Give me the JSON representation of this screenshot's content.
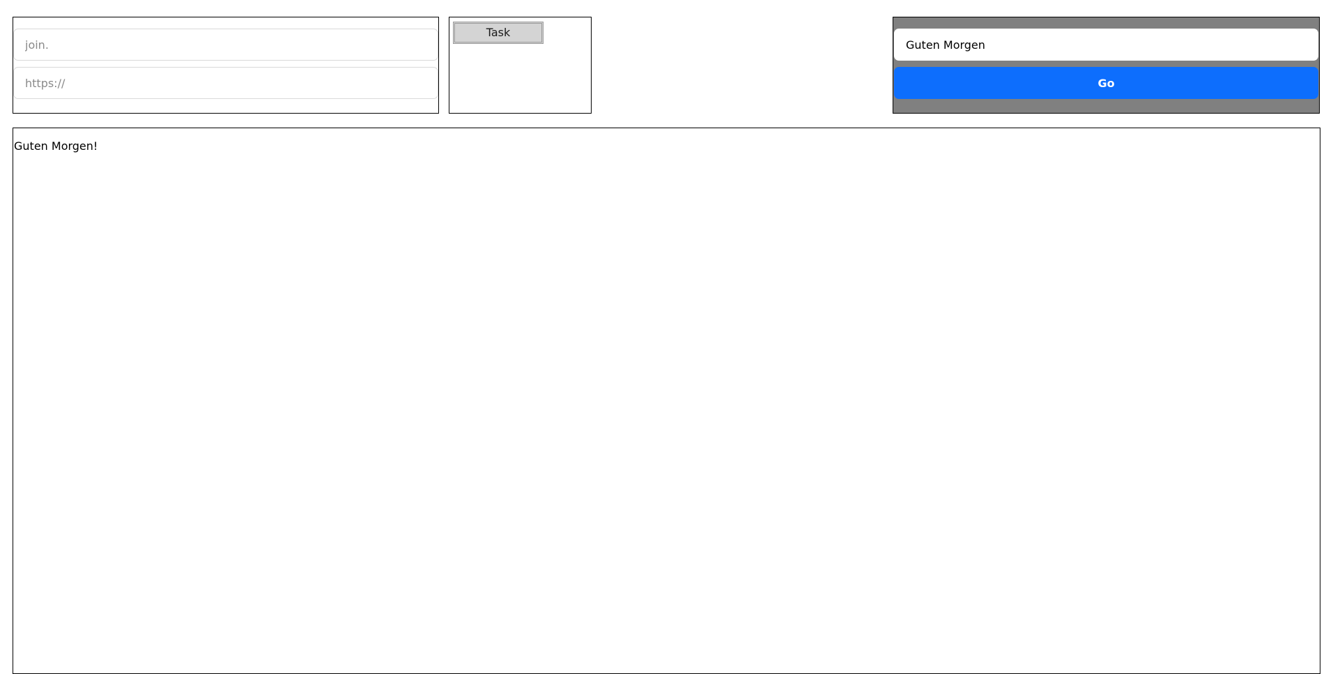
{
  "left_panel": {
    "join_placeholder": "join.",
    "url_placeholder": "https://"
  },
  "task_panel": {
    "button_label": "Task"
  },
  "search_panel": {
    "query_value": "Guten Morgen",
    "go_label": "Go"
  },
  "output": {
    "text": "Guten Morgen!"
  },
  "colors": {
    "search_panel_bg": "#808080",
    "go_button_bg": "#0d6efd",
    "task_button_bg": "#d4d4d4"
  }
}
